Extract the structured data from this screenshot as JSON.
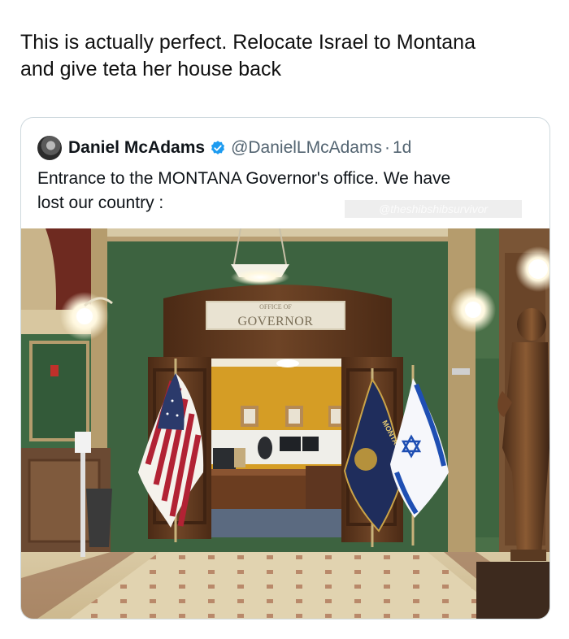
{
  "post": {
    "text_line1": "This is actually perfect. Relocate Israel to Montana",
    "text_line2": "and give teta her house back"
  },
  "quote": {
    "author_name": "Daniel McAdams",
    "handle": "@DanielLMcAdams",
    "separator": "·",
    "age": "1d",
    "text_line1": "Entrance to the MONTANA Governor's office. We have",
    "text_line2": "lost our country :",
    "watermark": "@theshibshibsurvivor"
  },
  "photo": {
    "door_sign": "GOVERNOR",
    "sign_above": "OFFICE OF",
    "flag_text": "MONTANA"
  },
  "colors": {
    "verified": "#1d9bf0",
    "wall_green": "#3f6541",
    "office_yellow": "#d39a22",
    "wood": "#6a3f22"
  }
}
